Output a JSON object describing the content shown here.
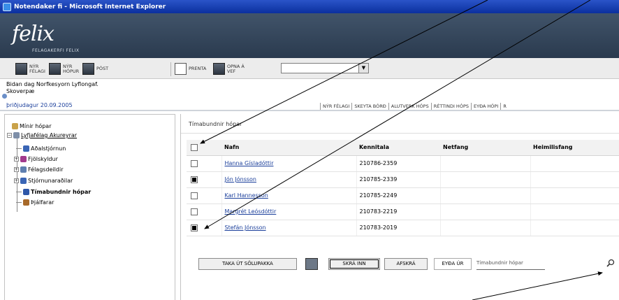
{
  "window": {
    "title": "Notendaker fi - Microsoft Internet Explorer"
  },
  "brand": {
    "logo": "felix",
    "tagline": "FELAGAKERFI FELIX"
  },
  "toolbar": {
    "buttons": [
      {
        "label": "NÝR\nFÉLAGI",
        "icon": "new-member-icon"
      },
      {
        "label": "NÝR\nHÓPUR",
        "icon": "new-group-icon"
      },
      {
        "label": "PÓST",
        "icon": "mail-icon"
      },
      {
        "label": "PRENTA",
        "icon": "print-icon"
      },
      {
        "label": "OPNA Á\nVEF",
        "icon": "web-icon"
      }
    ],
    "select_value": ""
  },
  "info": {
    "line1": "Bidan dag Norfkesyorn Lyflongaf.",
    "line2": "Skoverpæ",
    "date": "þriðjudagur 20.09.2005",
    "tabs": [
      "NÝR FÉLAGI",
      "SKEYTA BÓRÐ",
      "ALUTVERK HÓPS",
      "RÉTTINDI HÓPS",
      "EYÐA HÓPI",
      "R"
    ]
  },
  "tree": {
    "root_label": "Mínir hópar",
    "group_label": "Lyfjafélag Akureyrar",
    "items": [
      {
        "label": "Aðalstjórnun",
        "color": "#3a65b5"
      },
      {
        "label": "Fjölskyldur",
        "color": "#a23a8c"
      },
      {
        "label": "Félagsdeildir",
        "color": "#5e7fb0"
      },
      {
        "label": "Stjórnunaraðilar",
        "color": "#3a65b5"
      },
      {
        "label": "Tímabundnir hópar",
        "color": "#2f57a8",
        "bold": true
      },
      {
        "label": "Þjálfarar",
        "color": "#a86a2a"
      }
    ]
  },
  "panel": {
    "title": "Tímabundnir hópar",
    "columns": [
      "Nafn",
      "Kennitala",
      "Netfang",
      "Heimilisfang"
    ],
    "rows": [
      {
        "name": "Hanna Gísladóttir",
        "kennitala": "210786-2359",
        "checked": false
      },
      {
        "name": "Jón Jónsson",
        "kennitala": "210785-2339",
        "checked": true
      },
      {
        "name": "Karl Hannesson",
        "kennitala": "210785-2249",
        "checked": false
      },
      {
        "name": "Margrét Leósdóttir",
        "kennitala": "210783-2219",
        "checked": false
      },
      {
        "name": "Stefán Jónsson",
        "kennitala": "210783-2019",
        "checked": true
      }
    ],
    "actions": {
      "add_label": "TAKA ÚT SÖLUPAKKA",
      "save_label": "SKRÁ INN",
      "remove_label": "AFSKRÁ",
      "delete_label": "EYÐA ÚR",
      "search_placeholder": "Tímabundnir hópar"
    }
  }
}
